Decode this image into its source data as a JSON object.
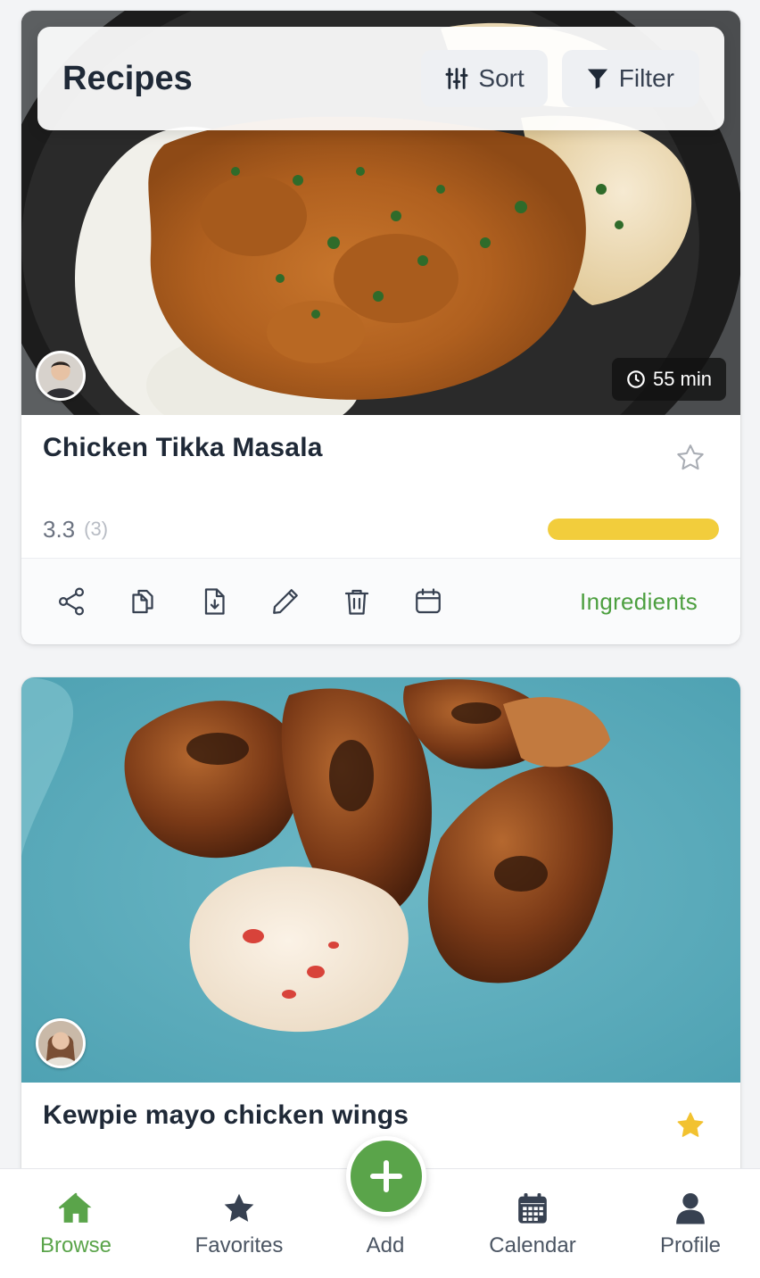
{
  "header": {
    "title": "Recipes",
    "sort_label": "Sort",
    "filter_label": "Filter"
  },
  "recipes": [
    {
      "title": "Chicken Tikka Masala",
      "time": "55 min",
      "rating": "3.3",
      "rating_count": "(3)",
      "rating_fraction": 1.0,
      "favorite": false,
      "author_avatar": "man-avatar",
      "image": "curry-rice-naan-photo",
      "actions": [
        "share-icon",
        "duplicate-icon",
        "download-icon",
        "edit-icon",
        "delete-icon",
        "calendar-icon"
      ],
      "ingredients_label": "Ingredients"
    },
    {
      "title": "Kewpie mayo chicken wings",
      "favorite": true,
      "author_avatar": "woman-avatar",
      "image": "chicken-wings-mayo-photo"
    }
  ],
  "nav": {
    "items": [
      {
        "label": "Browse",
        "icon": "home-icon",
        "active": true
      },
      {
        "label": "Favorites",
        "icon": "star-icon",
        "active": false
      },
      {
        "label": "Add",
        "icon": "plus-icon",
        "active": false
      },
      {
        "label": "Calendar",
        "icon": "calendar-icon",
        "active": false
      },
      {
        "label": "Profile",
        "icon": "user-icon",
        "active": false
      }
    ]
  },
  "colors": {
    "accent_green": "#5aa44a",
    "star_yellow": "#f2c230",
    "rating_bar": "#f2cd3c"
  }
}
